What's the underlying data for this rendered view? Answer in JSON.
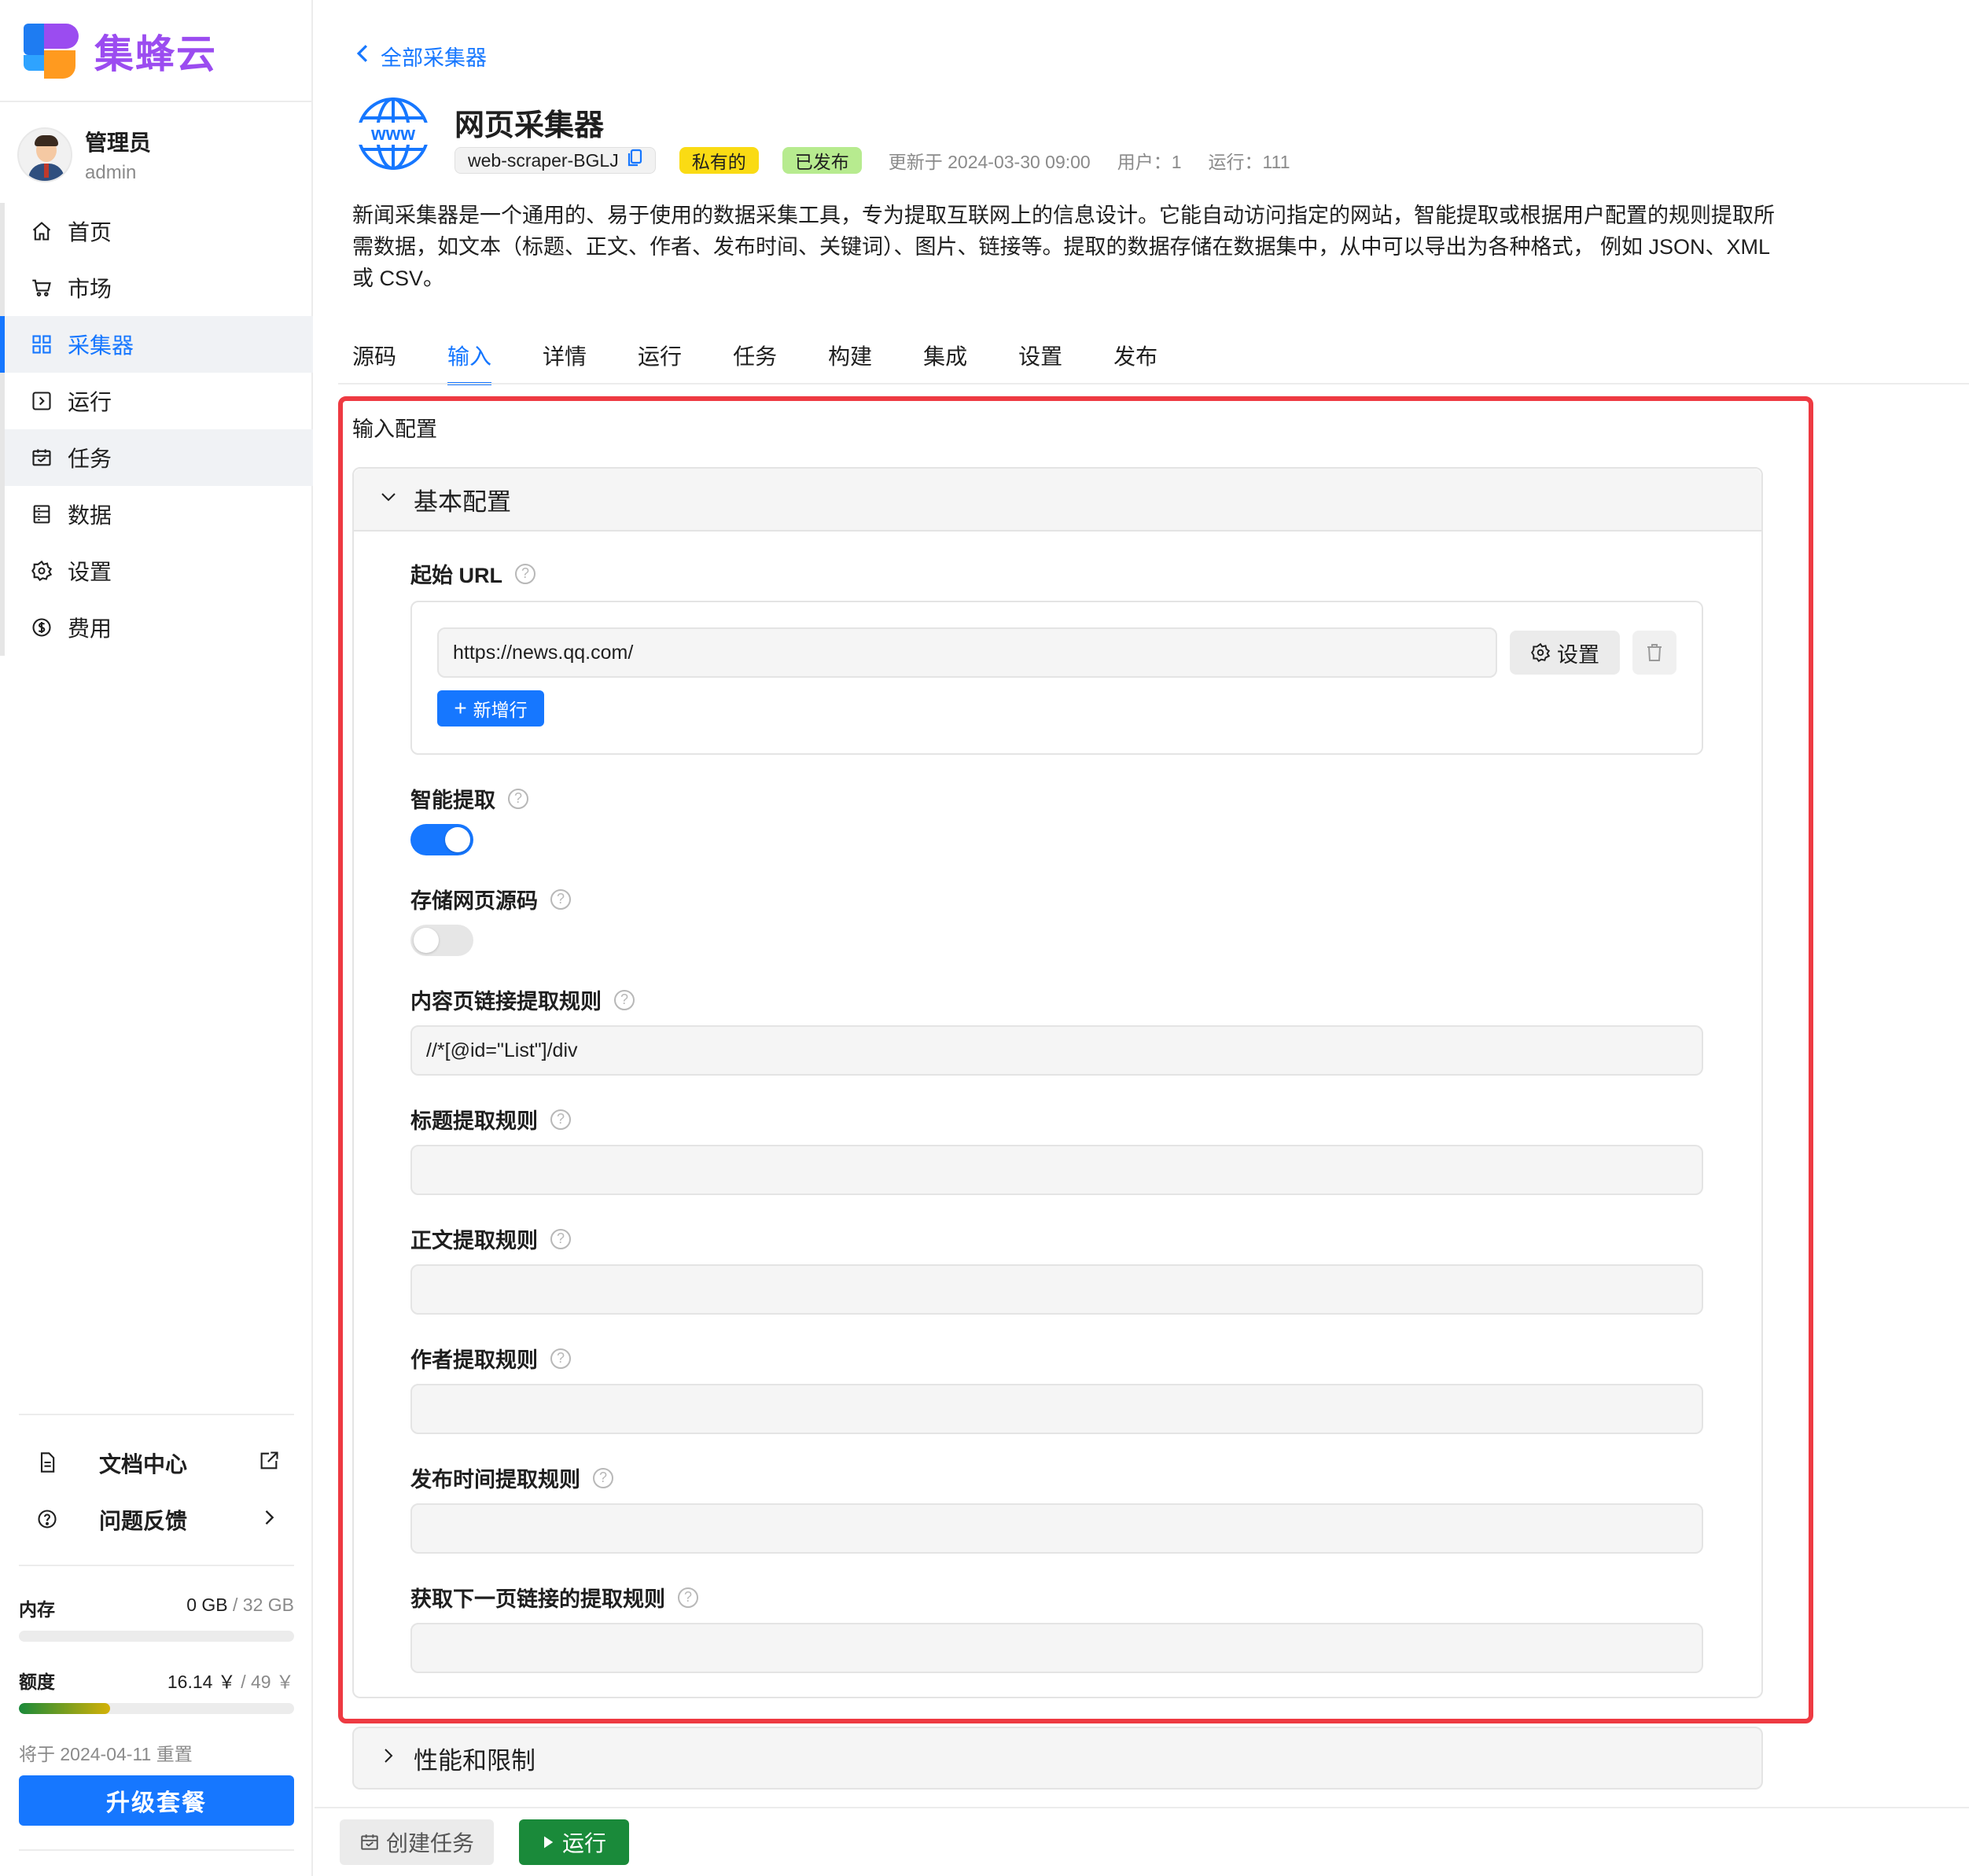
{
  "brand": {
    "name": "集蜂云"
  },
  "user": {
    "name": "管理员",
    "id": "admin"
  },
  "nav": {
    "items": [
      {
        "label": "首页",
        "icon": "home-icon"
      },
      {
        "label": "市场",
        "icon": "cart-icon"
      },
      {
        "label": "采集器",
        "icon": "grid-icon"
      },
      {
        "label": "运行",
        "icon": "run-icon"
      },
      {
        "label": "任务",
        "icon": "calendar-icon"
      },
      {
        "label": "数据",
        "icon": "database-icon"
      },
      {
        "label": "设置",
        "icon": "gear-icon"
      },
      {
        "label": "费用",
        "icon": "dollar-icon"
      }
    ]
  },
  "sidebar_links": {
    "docs": "文档中心",
    "feedback": "问题反馈"
  },
  "quota": {
    "memory_label": "内存",
    "memory_used": "0 GB",
    "memory_total": "/ 32 GB",
    "memory_fraction": 0,
    "credit_label": "额度",
    "credit_used": "16.14 ￥",
    "credit_total": "/ 49 ￥",
    "credit_fraction": 0.33,
    "reset_note": "将于 2024-04-11 重置",
    "upgrade": "升级套餐"
  },
  "header": {
    "back": "全部采集器",
    "title": "网页采集器",
    "id_tag": "web-scraper-BGLJ",
    "private_tag": "私有的",
    "published_tag": "已发布",
    "updated": "更新于 2024-03-30 09:00",
    "users": "用户：1",
    "runs": "运行：111",
    "description": "新闻采集器是一个通用的、易于使用的数据采集工具，专为提取互联网上的信息设计。它能自动访问指定的网站，智能提取或根据用户配置的规则提取所需数据，如文本（标题、正文、作者、发布时间、关键词）、图片、链接等。提取的数据存储在数据集中，从中可以导出为各种格式， 例如 JSON、XML 或 CSV。"
  },
  "tabs": [
    "源码",
    "输入",
    "详情",
    "运行",
    "任务",
    "构建",
    "集成",
    "设置",
    "发布"
  ],
  "input_config": {
    "section_title": "输入配置",
    "basic_title": "基本配置",
    "start_url_label": "起始 URL",
    "start_url_value": "https://news.qq.com/",
    "settings_button": "设置",
    "add_row": "新增行",
    "smart_extract_label": "智能提取",
    "smart_extract_on": true,
    "store_source_label": "存储网页源码",
    "store_source_on": false,
    "link_rule_label": "内容页链接提取规则",
    "link_rule_value": "//*[@id=\"List\"]/div",
    "title_rule_label": "标题提取规则",
    "title_rule_value": "",
    "body_rule_label": "正文提取规则",
    "body_rule_value": "",
    "author_rule_label": "作者提取规则",
    "author_rule_value": "",
    "time_rule_label": "发布时间提取规则",
    "time_rule_value": "",
    "next_rule_label": "获取下一页链接的提取规则",
    "next_rule_value": "",
    "perf_title": "性能和限制"
  },
  "footer": {
    "create_task": "创建任务",
    "run": "运行"
  },
  "colors": {
    "accent": "#1677ff",
    "brand": "#9b4cf0",
    "highlight": "#ee3a42",
    "run": "#1a8a3a"
  }
}
